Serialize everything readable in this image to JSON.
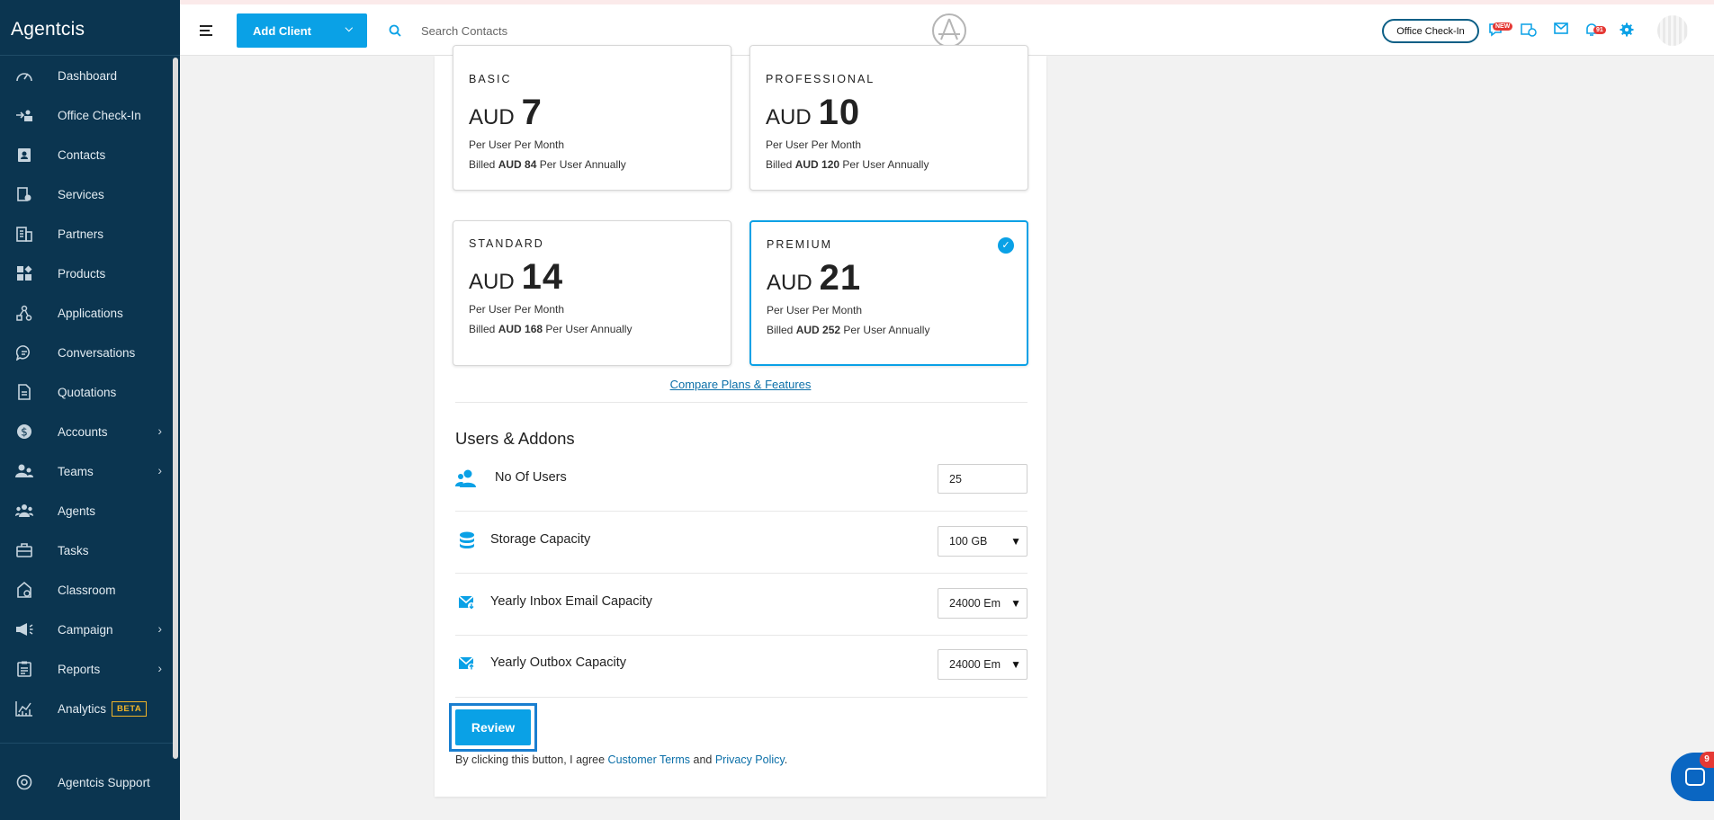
{
  "app": {
    "name": "Agentcis"
  },
  "sidebar": {
    "items": [
      {
        "label": "Dashboard",
        "icon": "dashboard-icon",
        "chevron": false
      },
      {
        "label": "Office Check-In",
        "icon": "check-in-icon",
        "chevron": false
      },
      {
        "label": "Contacts",
        "icon": "contacts-icon",
        "chevron": false
      },
      {
        "label": "Services",
        "icon": "services-icon",
        "chevron": false
      },
      {
        "label": "Partners",
        "icon": "partners-icon",
        "chevron": false
      },
      {
        "label": "Products",
        "icon": "products-icon",
        "chevron": false
      },
      {
        "label": "Applications",
        "icon": "applications-icon",
        "chevron": false
      },
      {
        "label": "Conversations",
        "icon": "conversations-icon",
        "chevron": false
      },
      {
        "label": "Quotations",
        "icon": "quotations-icon",
        "chevron": false
      },
      {
        "label": "Accounts",
        "icon": "accounts-icon",
        "chevron": true
      },
      {
        "label": "Teams",
        "icon": "teams-icon",
        "chevron": true
      },
      {
        "label": "Agents",
        "icon": "agents-icon",
        "chevron": false
      },
      {
        "label": "Tasks",
        "icon": "tasks-icon",
        "chevron": false
      },
      {
        "label": "Classroom",
        "icon": "classroom-icon",
        "chevron": false
      },
      {
        "label": "Campaign",
        "icon": "campaign-icon",
        "chevron": true
      },
      {
        "label": "Reports",
        "icon": "reports-icon",
        "chevron": true
      },
      {
        "label": "Analytics",
        "icon": "analytics-icon",
        "chevron": false,
        "badge": "BETA"
      }
    ],
    "support": {
      "label": "Agentcis Support",
      "icon": "support-icon"
    }
  },
  "header": {
    "add_client_label": "Add Client",
    "search_placeholder": "Search Contacts",
    "office_checkin_label": "Office Check-In",
    "new_badge": "NEW",
    "notification_count": "91"
  },
  "plans": [
    {
      "name": "BASIC",
      "currency": "AUD",
      "amount": "7",
      "per": "Per User Per Month",
      "billed_prefix": "Billed",
      "billed_amount": "AUD 84",
      "billed_suffix": "Per User Annually",
      "selected": false
    },
    {
      "name": "PROFESSIONAL",
      "currency": "AUD",
      "amount": "10",
      "per": "Per User Per Month",
      "billed_prefix": "Billed",
      "billed_amount": "AUD 120",
      "billed_suffix": "Per User Annually",
      "selected": false
    },
    {
      "name": "STANDARD",
      "currency": "AUD",
      "amount": "14",
      "per": "Per User Per Month",
      "billed_prefix": "Billed",
      "billed_amount": "AUD 168",
      "billed_suffix": "Per User Annually",
      "selected": false
    },
    {
      "name": "PREMIUM",
      "currency": "AUD",
      "amount": "21",
      "per": "Per User Per Month",
      "billed_prefix": "Billed",
      "billed_amount": "AUD 252",
      "billed_suffix": "Per User Annually",
      "selected": true
    }
  ],
  "compare_link": "Compare Plans & Features",
  "addons": {
    "title": "Users & Addons",
    "users": {
      "label": "No Of Users",
      "value": "25"
    },
    "storage": {
      "label": "Storage Capacity",
      "value": "100 GB"
    },
    "inbox": {
      "label": "Yearly Inbox Email Capacity",
      "value": "24000 Em"
    },
    "outbox": {
      "label": "Yearly Outbox Capacity",
      "value": "24000 Em"
    }
  },
  "review_label": "Review",
  "terms": {
    "prefix": "By clicking this button, I agree",
    "customer_terms": "Customer Terms",
    "and": "and",
    "privacy": "Privacy Policy",
    "suffix": "."
  },
  "chat": {
    "badge": "9"
  },
  "colors": {
    "sidebar": "#0b3550",
    "accent": "#0aa1e6",
    "link": "#0b6fa8"
  }
}
